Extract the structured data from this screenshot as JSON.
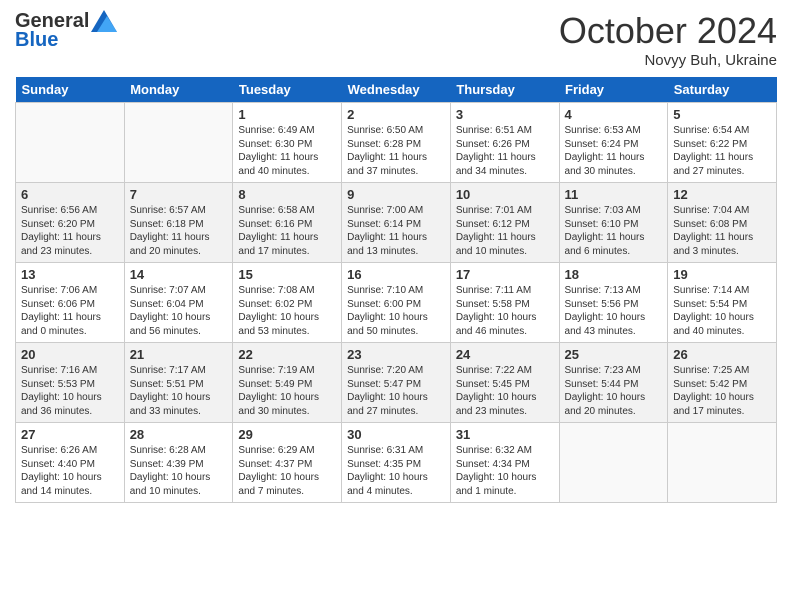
{
  "header": {
    "logo_line1": "General",
    "logo_line2": "Blue",
    "month": "October 2024",
    "location": "Novyy Buh, Ukraine"
  },
  "days_of_week": [
    "Sunday",
    "Monday",
    "Tuesday",
    "Wednesday",
    "Thursday",
    "Friday",
    "Saturday"
  ],
  "weeks": [
    [
      {
        "day": "",
        "info": ""
      },
      {
        "day": "",
        "info": ""
      },
      {
        "day": "1",
        "info": "Sunrise: 6:49 AM\nSunset: 6:30 PM\nDaylight: 11 hours and 40 minutes."
      },
      {
        "day": "2",
        "info": "Sunrise: 6:50 AM\nSunset: 6:28 PM\nDaylight: 11 hours and 37 minutes."
      },
      {
        "day": "3",
        "info": "Sunrise: 6:51 AM\nSunset: 6:26 PM\nDaylight: 11 hours and 34 minutes."
      },
      {
        "day": "4",
        "info": "Sunrise: 6:53 AM\nSunset: 6:24 PM\nDaylight: 11 hours and 30 minutes."
      },
      {
        "day": "5",
        "info": "Sunrise: 6:54 AM\nSunset: 6:22 PM\nDaylight: 11 hours and 27 minutes."
      }
    ],
    [
      {
        "day": "6",
        "info": "Sunrise: 6:56 AM\nSunset: 6:20 PM\nDaylight: 11 hours and 23 minutes."
      },
      {
        "day": "7",
        "info": "Sunrise: 6:57 AM\nSunset: 6:18 PM\nDaylight: 11 hours and 20 minutes."
      },
      {
        "day": "8",
        "info": "Sunrise: 6:58 AM\nSunset: 6:16 PM\nDaylight: 11 hours and 17 minutes."
      },
      {
        "day": "9",
        "info": "Sunrise: 7:00 AM\nSunset: 6:14 PM\nDaylight: 11 hours and 13 minutes."
      },
      {
        "day": "10",
        "info": "Sunrise: 7:01 AM\nSunset: 6:12 PM\nDaylight: 11 hours and 10 minutes."
      },
      {
        "day": "11",
        "info": "Sunrise: 7:03 AM\nSunset: 6:10 PM\nDaylight: 11 hours and 6 minutes."
      },
      {
        "day": "12",
        "info": "Sunrise: 7:04 AM\nSunset: 6:08 PM\nDaylight: 11 hours and 3 minutes."
      }
    ],
    [
      {
        "day": "13",
        "info": "Sunrise: 7:06 AM\nSunset: 6:06 PM\nDaylight: 11 hours and 0 minutes."
      },
      {
        "day": "14",
        "info": "Sunrise: 7:07 AM\nSunset: 6:04 PM\nDaylight: 10 hours and 56 minutes."
      },
      {
        "day": "15",
        "info": "Sunrise: 7:08 AM\nSunset: 6:02 PM\nDaylight: 10 hours and 53 minutes."
      },
      {
        "day": "16",
        "info": "Sunrise: 7:10 AM\nSunset: 6:00 PM\nDaylight: 10 hours and 50 minutes."
      },
      {
        "day": "17",
        "info": "Sunrise: 7:11 AM\nSunset: 5:58 PM\nDaylight: 10 hours and 46 minutes."
      },
      {
        "day": "18",
        "info": "Sunrise: 7:13 AM\nSunset: 5:56 PM\nDaylight: 10 hours and 43 minutes."
      },
      {
        "day": "19",
        "info": "Sunrise: 7:14 AM\nSunset: 5:54 PM\nDaylight: 10 hours and 40 minutes."
      }
    ],
    [
      {
        "day": "20",
        "info": "Sunrise: 7:16 AM\nSunset: 5:53 PM\nDaylight: 10 hours and 36 minutes."
      },
      {
        "day": "21",
        "info": "Sunrise: 7:17 AM\nSunset: 5:51 PM\nDaylight: 10 hours and 33 minutes."
      },
      {
        "day": "22",
        "info": "Sunrise: 7:19 AM\nSunset: 5:49 PM\nDaylight: 10 hours and 30 minutes."
      },
      {
        "day": "23",
        "info": "Sunrise: 7:20 AM\nSunset: 5:47 PM\nDaylight: 10 hours and 27 minutes."
      },
      {
        "day": "24",
        "info": "Sunrise: 7:22 AM\nSunset: 5:45 PM\nDaylight: 10 hours and 23 minutes."
      },
      {
        "day": "25",
        "info": "Sunrise: 7:23 AM\nSunset: 5:44 PM\nDaylight: 10 hours and 20 minutes."
      },
      {
        "day": "26",
        "info": "Sunrise: 7:25 AM\nSunset: 5:42 PM\nDaylight: 10 hours and 17 minutes."
      }
    ],
    [
      {
        "day": "27",
        "info": "Sunrise: 6:26 AM\nSunset: 4:40 PM\nDaylight: 10 hours and 14 minutes."
      },
      {
        "day": "28",
        "info": "Sunrise: 6:28 AM\nSunset: 4:39 PM\nDaylight: 10 hours and 10 minutes."
      },
      {
        "day": "29",
        "info": "Sunrise: 6:29 AM\nSunset: 4:37 PM\nDaylight: 10 hours and 7 minutes."
      },
      {
        "day": "30",
        "info": "Sunrise: 6:31 AM\nSunset: 4:35 PM\nDaylight: 10 hours and 4 minutes."
      },
      {
        "day": "31",
        "info": "Sunrise: 6:32 AM\nSunset: 4:34 PM\nDaylight: 10 hours and 1 minute."
      },
      {
        "day": "",
        "info": ""
      },
      {
        "day": "",
        "info": ""
      }
    ]
  ]
}
